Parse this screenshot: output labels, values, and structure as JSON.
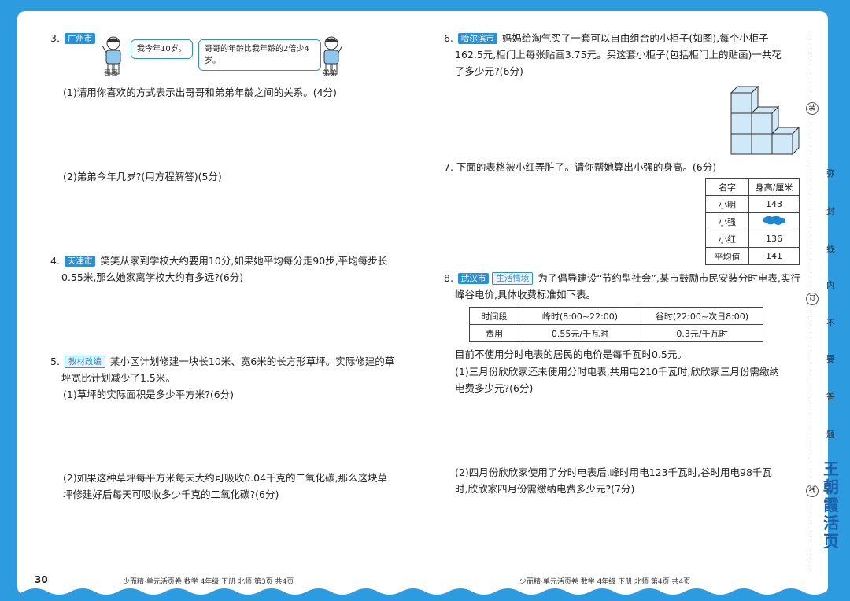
{
  "page_number": "30",
  "left": {
    "q3": {
      "num": "3.",
      "tag": "广州市",
      "bubble_brother": "我今年10岁。",
      "bubble_younger": "哥哥的年龄比我年龄的2倍少4岁。",
      "label_brother": "哥哥",
      "label_younger": "弟弟",
      "p1": "(1)请用你喜欢的方式表示出哥哥和弟弟年龄之间的关系。(4分)",
      "p2": "(2)弟弟今年几岁?(用方程解答)(5分)"
    },
    "q4": {
      "num": "4.",
      "tag": "天津市",
      "line1": "笑笑从家到学校大约要用10分,如果她平均每分走90步,平均每步长",
      "line2": "0.55米,那么她家离学校大约有多远?(6分)"
    },
    "q5": {
      "num": "5.",
      "tag": "教材改编",
      "line1": "某小区计划修建一块长10米、宽6米的长方形草坪。实际修建的草",
      "line2": "坪宽比计划减少了1.5米。",
      "p1": "(1)草坪的实际面积是多少平方米?(6分)",
      "p2_line1": "(2)如果这种草坪每平方米每天大约可吸收0.04千克的二氧化碳,那么这块草",
      "p2_line2": "坪修建好后每天可吸收多少千克的二氧化碳?(6分)"
    },
    "footer": "少而精·单元活页卷  数学  4年级  下册  北师  第3页  共4页"
  },
  "right": {
    "q6": {
      "num": "6.",
      "tag": "哈尔滨市",
      "line1": "妈妈给淘气买了一套可以自由组合的小柜子(如图),每个小柜子",
      "line2": "162.5元,柜门上每张贴画3.75元。买这套小柜子(包括柜门上的贴画)一共花",
      "line3": "了多少元?(6分)"
    },
    "q7": {
      "num": "7.",
      "text": "下面的表格被小红弄脏了。请你帮她算出小强的身高。(6分)",
      "headers": [
        "名字",
        "身高/厘米"
      ],
      "rows": [
        [
          "小明",
          "143"
        ],
        [
          "小强",
          ""
        ],
        [
          "小红",
          "136"
        ],
        [
          "平均值",
          "141"
        ]
      ]
    },
    "q8": {
      "num": "8.",
      "tag1": "武汉市",
      "tag2": "生活情境",
      "line1": "为了倡导建设“节约型社会”,某市鼓励市民安装分时电表,实行",
      "line2": "峰谷电价,具体收费标准如下表。",
      "table": {
        "row1": [
          "时间段",
          "峰时(8:00~22:00)",
          "谷时(22:00~次日8:00)"
        ],
        "row2": [
          "费用",
          "0.55元/千瓦时",
          "0.3元/千瓦时"
        ]
      },
      "note": "目前不使用分时电表的居民的电价是每千瓦时0.5元。",
      "p1_line1": "(1)三月份欣欣家还未使用分时电表,共用电210千瓦时,欣欣家三月份需缴纳",
      "p1_line2": "电费多少元?(6分)",
      "p2_line1": "(2)四月份欣欣家使用了分时电表后,峰时用电123千瓦时,谷时用电98千瓦",
      "p2_line2": "时,欣欣家四月份需缴纳电费多少元?(7分)"
    },
    "footer": "少而精·单元活页卷  数学  4年级  下册  北师  第4页  共4页"
  },
  "binding": {
    "chars": [
      "弥",
      "封",
      "线",
      "内",
      "不",
      "要",
      "答",
      "题"
    ],
    "circle_top": "装",
    "circle_mid": "订",
    "circle_bottom": "线",
    "brand": "王朝霞活页"
  },
  "colors": {
    "accent": "#2b8fd6",
    "frame": "#2c9be0"
  }
}
